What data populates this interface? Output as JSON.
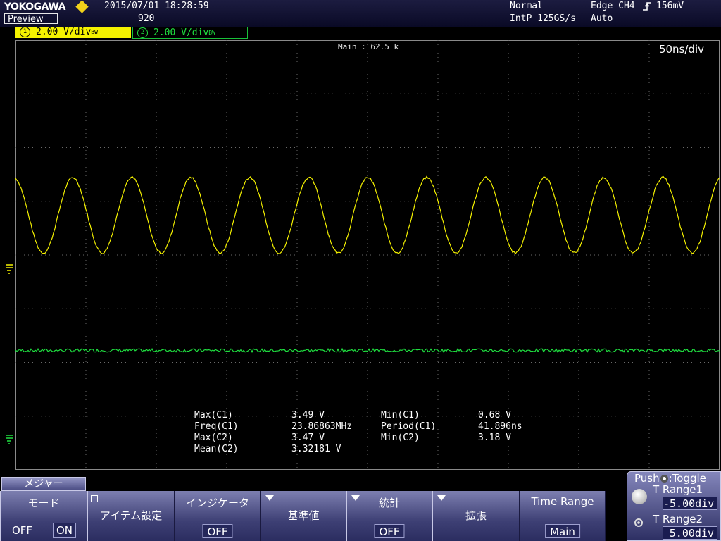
{
  "topbar": {
    "brand": "YOKOGAWA",
    "mode_label": "Preview",
    "datetime": "2015/07/01  18:28:59",
    "record_count": "920",
    "trigger_mode": "Normal",
    "sample_rate": "IntP  125GS/s",
    "trigger_source": "Edge CH4",
    "trigger_level": "156mV",
    "acq_mode": "Auto"
  },
  "channels": [
    {
      "num": "1",
      "scale": "2.00 V",
      "unit": "/div",
      "bw": "BW",
      "color": "#f5f200"
    },
    {
      "num": "2",
      "scale": "2.00 V",
      "unit": "/div",
      "bw": "BW",
      "color": "#1fe040"
    }
  ],
  "display": {
    "main_label": "Main : 62.5 k",
    "time_div": "50ns/div"
  },
  "measurements": [
    {
      "name": "Max(C1)",
      "value": "3.49 V",
      "name2": "Min(C1)",
      "value2": "0.68 V"
    },
    {
      "name": "Freq(C1)",
      "value": "23.86863MHz",
      "name2": "Period(C1)",
      "value2": "41.896ns"
    },
    {
      "name": "Max(C2)",
      "value": "3.47 V",
      "name2": "Min(C2)",
      "value2": "3.18 V"
    },
    {
      "name": "Mean(C2)",
      "value": "3.32181 V",
      "name2": "",
      "value2": ""
    }
  ],
  "menu": {
    "title": "メジャー",
    "keys": [
      {
        "label": "モード",
        "opt_off": "OFF",
        "opt_on": "ON"
      },
      {
        "label": "アイテム設定"
      },
      {
        "label": "インジケータ",
        "value": "OFF"
      },
      {
        "label": "基準値"
      },
      {
        "label": "統計",
        "value": "OFF"
      },
      {
        "label": "拡張"
      },
      {
        "label": "Time Range",
        "value": "Main"
      }
    ]
  },
  "jog": {
    "header": "Push",
    "header_action": ":Toggle",
    "range1_label": "T Range1",
    "range1_value": "-5.00div",
    "range2_label": "T Range2",
    "range2_value": "5.00div"
  }
}
